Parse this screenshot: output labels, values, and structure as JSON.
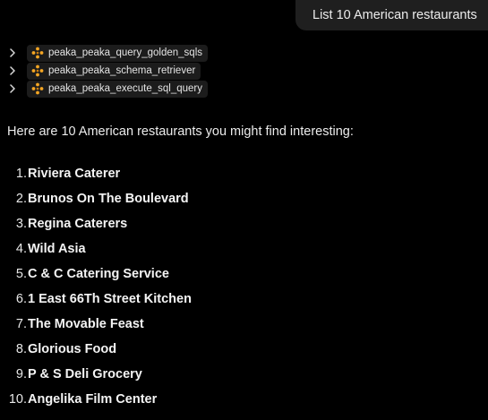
{
  "user_message": "List 10 American restaurants",
  "tool_calls": [
    {
      "label": "peaka_peaka_query_golden_sqls",
      "icon": "peaka-logo-icon"
    },
    {
      "label": "peaka_peaka_schema_retriever",
      "icon": "peaka-logo-icon"
    },
    {
      "label": "peaka_peaka_execute_sql_query",
      "icon": "peaka-logo-icon"
    }
  ],
  "response": {
    "intro": "Here are 10 American restaurants you might find interesting:",
    "items": [
      {
        "num": "1.",
        "name": "Riviera Caterer"
      },
      {
        "num": "2.",
        "name": "Brunos On The Boulevard"
      },
      {
        "num": "3.",
        "name": "Regina Caterers"
      },
      {
        "num": "4.",
        "name": "Wild Asia"
      },
      {
        "num": "5.",
        "name": "C & C Catering Service"
      },
      {
        "num": "6.",
        "name": "1 East 66Th Street Kitchen"
      },
      {
        "num": "7.",
        "name": "The Movable Feast"
      },
      {
        "num": "8.",
        "name": "Glorious Food"
      },
      {
        "num": "9.",
        "name": "P & S Deli Grocery"
      },
      {
        "num": "10.",
        "name": "Angelika Film Center"
      }
    ]
  },
  "colors": {
    "background": "#000000",
    "bubble": "#1f1f1f",
    "chip": "#1c1c1c",
    "logo_accent": "#f5a623"
  }
}
